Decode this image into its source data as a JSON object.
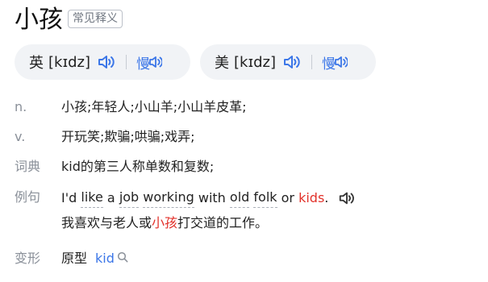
{
  "word": "小孩",
  "badge": "常见释义",
  "pronunciations": [
    {
      "region": "英",
      "phonetic": "[kɪdz]",
      "speaker_icon": "speaker-icon",
      "slow_label": "慢",
      "slow_icon": "slow-play-icon"
    },
    {
      "region": "美",
      "phonetic": "[kɪdz]",
      "speaker_icon": "speaker-icon",
      "slow_label": "慢",
      "slow_icon": "slow-play-icon"
    }
  ],
  "definitions": [
    {
      "pos": "n.",
      "text": "小孩;年轻人;小山羊;小山羊皮革;"
    },
    {
      "pos": "v.",
      "text": "开玩笑;欺骗;哄骗;戏弄;"
    },
    {
      "pos": "词典",
      "text": "kid的第三人称单数和复数;"
    }
  ],
  "example": {
    "label": "例句",
    "en_words": [
      "I'd",
      "like",
      "a",
      "job",
      "working",
      "with",
      "old",
      "folk",
      "or"
    ],
    "en_highlight": "kids",
    "en_end": ".",
    "zh_before": "我喜欢与老人或",
    "zh_highlight": "小孩",
    "zh_after": "打交道的工作。"
  },
  "forms": {
    "label": "变形",
    "type": "原型",
    "value": "kid"
  },
  "colors": {
    "accent": "#3b76e8",
    "highlight": "#e2322b",
    "muted": "#8a9099"
  }
}
